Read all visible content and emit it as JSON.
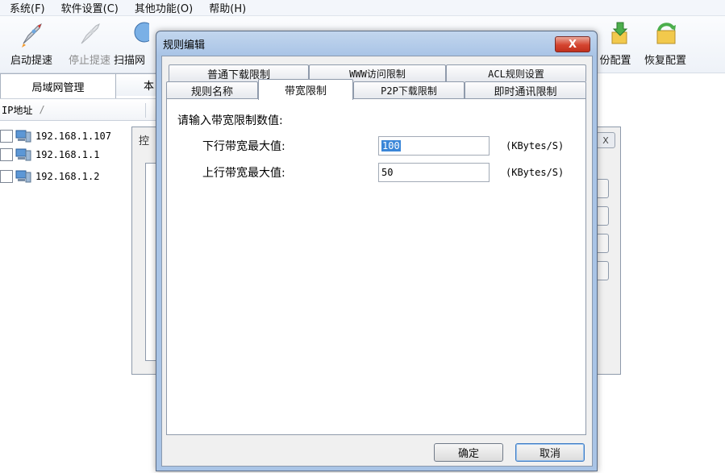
{
  "menu": [
    "系统(F)",
    "软件设置(C)",
    "其他功能(O)",
    "帮助(H)"
  ],
  "toolbar": {
    "start_label": "启动提速",
    "stop_label": "停止提速",
    "scan_label": "扫描网",
    "backup_label": "备份配置",
    "backup_partial": "份配置",
    "restore_label": "恢复配置"
  },
  "lan_tabs": {
    "lan_mgmt": "局域网管理",
    "local": "本"
  },
  "lan_list": {
    "header": "IP地址",
    "sort_indicator": "/",
    "rows": [
      "192.168.1.107",
      "192.168.1.1",
      "192.168.1.2"
    ]
  },
  "bg_dialog": {
    "title_partial": "控",
    "close": "X"
  },
  "dialog": {
    "title": "规则编辑",
    "close": "X",
    "tabs_back": [
      "普通下载限制",
      "WWW访问限制",
      "ACL规则设置"
    ],
    "tabs_front": [
      "规则名称",
      "带宽限制",
      "P2P下载限制",
      "即时通讯限制"
    ],
    "active_tab": "带宽限制",
    "prompt": "请输入带宽限制数值:",
    "fields": [
      {
        "label": "下行带宽最大值:",
        "value": "100",
        "unit": "(KBytes/S)"
      },
      {
        "label": "上行带宽最大值:",
        "value": "50",
        "unit": "(KBytes/S)"
      }
    ],
    "ok": "确定",
    "cancel": "取消"
  }
}
